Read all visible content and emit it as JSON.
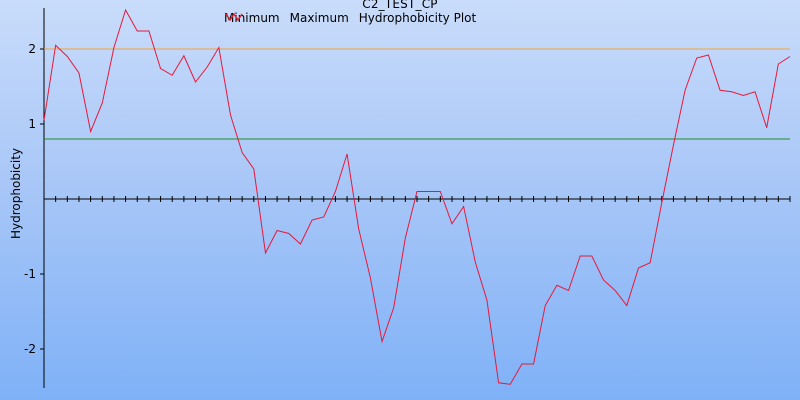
{
  "chart_data": {
    "type": "line",
    "title": "C2_TEST_CP",
    "xlabel": "",
    "ylabel": "Hydrophobicity",
    "ylim": [
      -2.55,
      2.55
    ],
    "xlim": [
      1,
      65
    ],
    "yticks": [
      -2,
      -1,
      1,
      2
    ],
    "ytick_labels": [
      "-2",
      "-1",
      "1",
      "2"
    ],
    "grid": false,
    "legend_position": "top",
    "series": [
      {
        "name": "Minimum",
        "color": "#f2a23a",
        "x": [
          1,
          65
        ],
        "y": [
          2.0,
          2.0
        ]
      },
      {
        "name": "Maximum",
        "color": "#1f8f1f",
        "x": [
          1,
          65
        ],
        "y": [
          0.8,
          0.8
        ]
      },
      {
        "name": "Hydrophobicity Plot",
        "color": "#e6193b",
        "x": [
          1,
          2,
          3,
          4,
          5,
          6,
          7,
          8,
          9,
          10,
          11,
          12,
          13,
          14,
          15,
          16,
          17,
          18,
          19,
          20,
          21,
          22,
          23,
          24,
          25,
          26,
          27,
          28,
          29,
          30,
          31,
          32,
          33,
          34,
          35,
          36,
          37,
          38,
          39,
          40,
          41,
          42,
          43,
          44,
          45,
          46,
          47,
          48,
          49,
          50,
          51,
          52,
          53,
          54,
          55,
          56,
          57,
          58,
          59,
          60,
          61,
          62,
          63,
          64,
          65
        ],
        "y": [
          1.05,
          2.05,
          1.9,
          1.68,
          0.9,
          1.28,
          2.02,
          2.52,
          2.24,
          2.24,
          1.74,
          1.65,
          1.91,
          1.56,
          1.76,
          2.02,
          1.12,
          0.62,
          0.4,
          -0.72,
          -0.42,
          -0.46,
          -0.6,
          -0.28,
          -0.24,
          0.1,
          0.6,
          -0.4,
          -1.05,
          -1.9,
          -1.45,
          -0.52,
          0.1,
          0.1,
          0.1,
          -0.33,
          -0.1,
          -0.84,
          -1.35,
          -2.45,
          -2.47,
          -2.2,
          -2.2,
          -1.42,
          -1.15,
          -1.22,
          -0.76,
          -0.76,
          -1.08,
          -1.22,
          -1.42,
          -0.92,
          -0.85,
          -0.05,
          0.72,
          1.45,
          1.88,
          1.92,
          1.45,
          1.43,
          1.38,
          1.43,
          0.95,
          1.8,
          1.9
        ]
      }
    ]
  }
}
